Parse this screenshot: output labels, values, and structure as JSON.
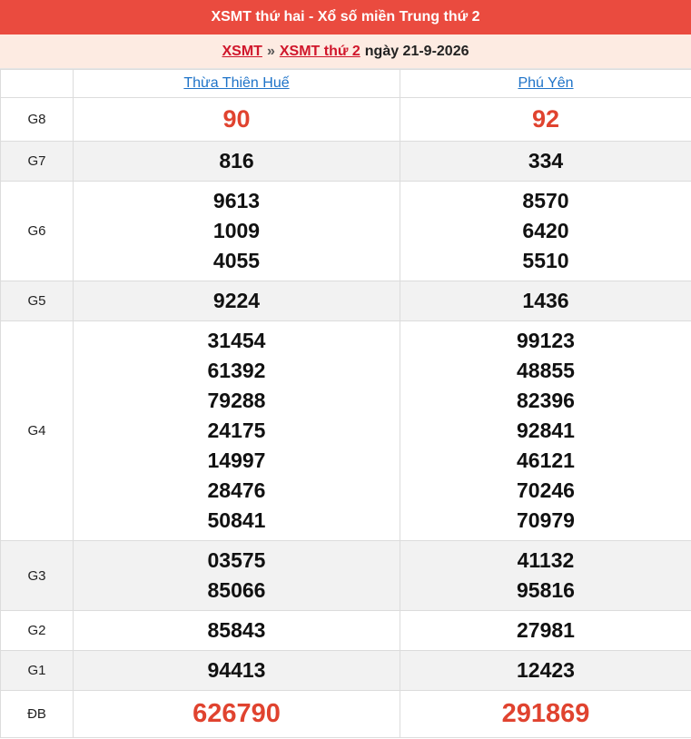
{
  "header": {
    "title": "XSMT thứ hai - Xổ số miền Trung thứ 2"
  },
  "breadcrumb": {
    "link1": "XSMT",
    "separator": "»",
    "link2": "XSMT thứ 2",
    "date_text": "ngày 21-9-2026"
  },
  "provinces": [
    "Thừa Thiên Huế",
    "Phú Yên"
  ],
  "prizes": {
    "g8": {
      "label": "G8",
      "values": [
        [
          "90"
        ],
        [
          "92"
        ]
      ]
    },
    "g7": {
      "label": "G7",
      "values": [
        [
          "816"
        ],
        [
          "334"
        ]
      ]
    },
    "g6": {
      "label": "G6",
      "values": [
        [
          "9613",
          "1009",
          "4055"
        ],
        [
          "8570",
          "6420",
          "5510"
        ]
      ]
    },
    "g5": {
      "label": "G5",
      "values": [
        [
          "9224"
        ],
        [
          "1436"
        ]
      ]
    },
    "g4": {
      "label": "G4",
      "values": [
        [
          "31454",
          "61392",
          "79288",
          "24175",
          "14997",
          "28476",
          "50841"
        ],
        [
          "99123",
          "48855",
          "82396",
          "92841",
          "46121",
          "70246",
          "70979"
        ]
      ]
    },
    "g3": {
      "label": "G3",
      "values": [
        [
          "03575",
          "85066"
        ],
        [
          "41132",
          "95816"
        ]
      ]
    },
    "g2": {
      "label": "G2",
      "values": [
        [
          "85843"
        ],
        [
          "27981"
        ]
      ]
    },
    "g1": {
      "label": "G1",
      "values": [
        [
          "94413"
        ],
        [
          "12423"
        ]
      ]
    },
    "db": {
      "label": "ĐB",
      "values": [
        [
          "626790"
        ],
        [
          "291869"
        ]
      ]
    }
  },
  "colors": {
    "header_bg": "#ea4b3f",
    "breadcrumb_bg": "#fdebe2",
    "red_number": "#e0432f",
    "province_link": "#1e73c8"
  }
}
